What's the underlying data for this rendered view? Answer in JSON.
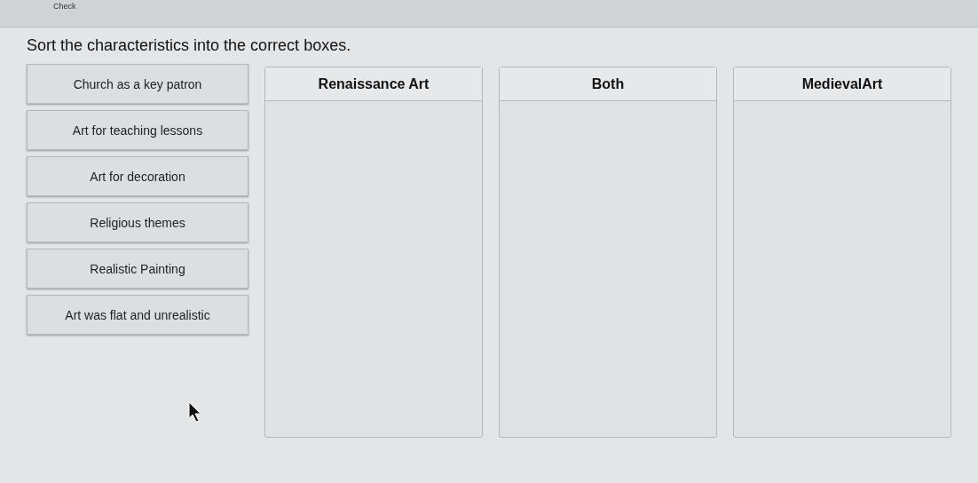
{
  "toolbar": {
    "button": "Check"
  },
  "instruction": "Sort the characteristics into the correct boxes.",
  "cards": [
    {
      "label": "Church as a key patron"
    },
    {
      "label": "Art for teaching lessons"
    },
    {
      "label": "Art for decoration"
    },
    {
      "label": "Religious themes"
    },
    {
      "label": "Realistic Painting"
    },
    {
      "label": "Art was flat and unrealistic"
    }
  ],
  "boxes": [
    {
      "title": "Renaissance Art"
    },
    {
      "title": "Both"
    },
    {
      "title": "MedievalArt"
    }
  ]
}
